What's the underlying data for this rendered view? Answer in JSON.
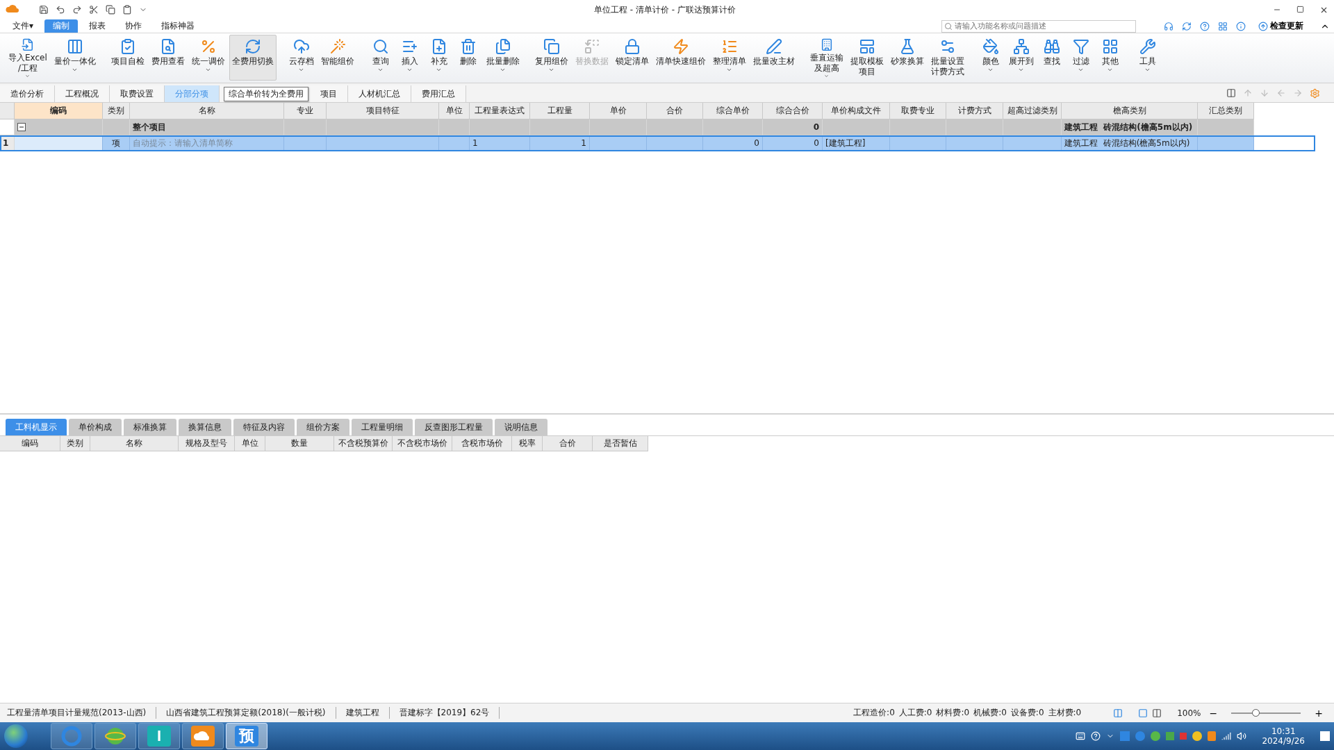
{
  "window": {
    "title": "单位工程 - 清单计价 - 广联达预算计价"
  },
  "menu": [
    {
      "label": "文件▾",
      "selected": false
    },
    {
      "label": "编制",
      "selected": true
    },
    {
      "label": "报表",
      "selected": false
    },
    {
      "label": "协作",
      "selected": false
    },
    {
      "label": "指标神器",
      "selected": false
    }
  ],
  "search": {
    "placeholder": "请输入功能名称或问题描述"
  },
  "update_button": "检查更新",
  "ribbon": [
    [
      {
        "label": "导入Excel\n/工程",
        "dropdown": true,
        "disabled": false,
        "pressed": false
      },
      {
        "label": "量价一体化",
        "dropdown": true,
        "disabled": false,
        "pressed": false
      }
    ],
    [
      {
        "label": "项目自检",
        "dropdown": false,
        "disabled": false,
        "pressed": false
      },
      {
        "label": "费用查看",
        "dropdown": false,
        "disabled": false,
        "pressed": false
      },
      {
        "label": "统一调价",
        "dropdown": true,
        "disabled": false,
        "pressed": false
      },
      {
        "label": "全费用切换",
        "dropdown": false,
        "disabled": false,
        "pressed": true
      }
    ],
    [
      {
        "label": "云存档",
        "dropdown": true,
        "disabled": false,
        "pressed": false
      },
      {
        "label": "智能组价",
        "dropdown": false,
        "disabled": false,
        "pressed": false
      }
    ],
    [
      {
        "label": "查询",
        "dropdown": true,
        "disabled": false,
        "pressed": false
      },
      {
        "label": "插入",
        "dropdown": true,
        "disabled": false,
        "pressed": false
      },
      {
        "label": "补充",
        "dropdown": true,
        "disabled": false,
        "pressed": false
      },
      {
        "label": "删除",
        "dropdown": false,
        "disabled": false,
        "pressed": false
      },
      {
        "label": "批量删除",
        "dropdown": true,
        "disabled": false,
        "pressed": false
      }
    ],
    [
      {
        "label": "复用组价",
        "dropdown": true,
        "disabled": false,
        "pressed": false
      },
      {
        "label": "替换数据",
        "dropdown": false,
        "disabled": true,
        "pressed": false
      },
      {
        "label": "锁定清单",
        "dropdown": false,
        "disabled": false,
        "pressed": false
      },
      {
        "label": "清单快速组价",
        "dropdown": false,
        "disabled": false,
        "pressed": false
      },
      {
        "label": "整理清单",
        "dropdown": true,
        "disabled": false,
        "pressed": false
      },
      {
        "label": "批量改主材",
        "dropdown": false,
        "disabled": false,
        "pressed": false
      }
    ],
    [
      {
        "lines": [
          "垂直运输",
          "及超高"
        ],
        "dropdown": true,
        "disabled": false,
        "pressed": false
      },
      {
        "lines": [
          "提取模板",
          "项目"
        ],
        "dropdown": false,
        "disabled": false,
        "pressed": false
      },
      {
        "label": "砂浆换算",
        "dropdown": false,
        "disabled": false,
        "pressed": false
      },
      {
        "lines": [
          "批量设置",
          "计费方式"
        ],
        "dropdown": false,
        "disabled": false,
        "pressed": false
      }
    ],
    [
      {
        "label": "颜色",
        "dropdown": true,
        "disabled": false,
        "pressed": false
      },
      {
        "label": "展开到",
        "dropdown": true,
        "disabled": false,
        "pressed": false
      },
      {
        "label": "查找",
        "dropdown": false,
        "disabled": false,
        "pressed": false
      },
      {
        "label": "过滤",
        "dropdown": true,
        "disabled": false,
        "pressed": false
      },
      {
        "label": "其他",
        "dropdown": true,
        "disabled": false,
        "pressed": false
      }
    ],
    [
      {
        "label": "工具",
        "dropdown": true,
        "disabled": false,
        "pressed": false
      }
    ]
  ],
  "view_tabs": [
    {
      "label": "造价分析",
      "selected": false
    },
    {
      "label": "工程概况",
      "selected": false
    },
    {
      "label": "取费设置",
      "selected": false
    },
    {
      "label": "分部分项",
      "selected": true
    },
    {
      "label": "项目",
      "selected": false
    },
    {
      "label": "人材机汇总",
      "selected": false
    },
    {
      "label": "费用汇总",
      "selected": false
    }
  ],
  "tooltip": "综合单价转为全费用",
  "table": {
    "columns": [
      "编码",
      "类别",
      "名称",
      "专业",
      "项目特征",
      "单位",
      "工程量表达式",
      "工程量",
      "单价",
      "合价",
      "综合单价",
      "综合合价",
      "单价构成文件",
      "取费专业",
      "计费方式",
      "超高过滤类别",
      "檐高类别",
      "汇总类别"
    ],
    "group": {
      "name": "整个项目",
      "expanded": true,
      "total": "0",
      "height_class": "建筑工程  砖混结构(檐高5m以内)"
    },
    "rows": [
      {
        "number": "1",
        "selected": true,
        "cells": [
          "",
          "项",
          "自动提示：请输入清单简称",
          "",
          "",
          "",
          "1",
          "1",
          "",
          "",
          "0",
          "0",
          "[建筑工程]",
          "",
          "",
          "",
          "建筑工程  砖混结构(檐高5m以内)",
          ""
        ]
      }
    ]
  },
  "detail_tabs": [
    {
      "label": "工料机显示",
      "selected": true
    },
    {
      "label": "单价构成",
      "selected": false
    },
    {
      "label": "标准换算",
      "selected": false
    },
    {
      "label": "换算信息",
      "selected": false
    },
    {
      "label": "特征及内容",
      "selected": false
    },
    {
      "label": "组价方案",
      "selected": false
    },
    {
      "label": "工程量明细",
      "selected": false
    },
    {
      "label": "反查图形工程量",
      "selected": false
    },
    {
      "label": "说明信息",
      "selected": false
    }
  ],
  "detail_columns": [
    "编码",
    "类别",
    "名称",
    "规格及型号",
    "单位",
    "数量",
    "不含税预算价",
    "不含税市场价",
    "含税市场价",
    "税率",
    "合价",
    "是否暂估"
  ],
  "status_bar": {
    "left": [
      "工程量清单项目计量规范(2013-山西)",
      "山西省建筑工程预算定额(2018)(一般计税)",
      "建筑工程",
      "晋建标字【2019】62号"
    ],
    "right": [
      "工程造价:0",
      "人工费:0",
      "材料费:0",
      "机械费:0",
      "设备费:0",
      "主材费:0"
    ],
    "zoom": "100%",
    "zoom_minus": "−",
    "zoom_plus": "+",
    "zoom_slider": {
      "level": 0.35
    }
  },
  "taskbar": {
    "apps": [
      {
        "kind": "swirl",
        "selected": false
      },
      {
        "kind": "browser",
        "selected": false
      },
      {
        "kind": "text",
        "label": "I",
        "selected": false
      },
      {
        "kind": "cloud",
        "selected": false
      },
      {
        "kind": "text",
        "label": "预",
        "selected": true
      }
    ],
    "time": "10:31",
    "date": "2024/9/26"
  }
}
